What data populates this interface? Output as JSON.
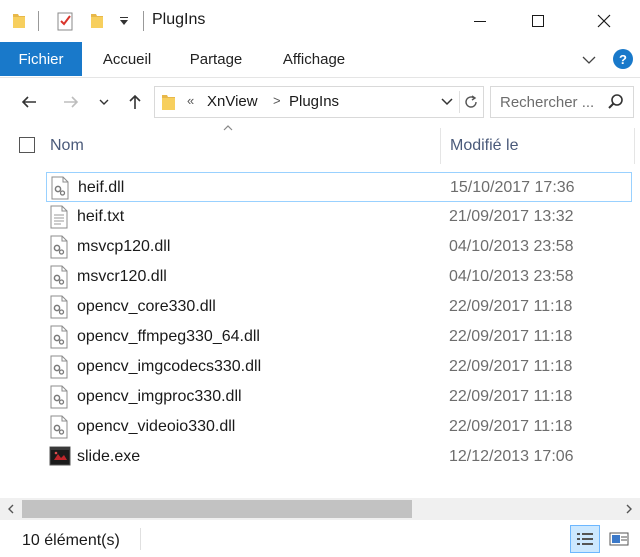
{
  "window": {
    "title": "PlugIns",
    "minimize_icon": "minimize-icon",
    "maximize_icon": "maximize-icon",
    "close_icon": "close-icon"
  },
  "quick_access": {
    "icons": [
      "folder-icon",
      "properties-icon",
      "new-folder-icon",
      "customize-dropdown-icon"
    ]
  },
  "ribbon": {
    "tabs": [
      {
        "label": "Fichier",
        "active": true
      },
      {
        "label": "Accueil"
      },
      {
        "label": "Partage"
      },
      {
        "label": "Affichage"
      }
    ],
    "accent": "#1979ca",
    "help_label": "?"
  },
  "address": {
    "overflow_marker": "«",
    "segments": [
      "XnView",
      "PlugIns"
    ],
    "separator": ">"
  },
  "search": {
    "placeholder": "Rechercher ..."
  },
  "columns": {
    "name": "Nom",
    "modified": "Modifié le"
  },
  "files": [
    {
      "name": "heif.dll",
      "modified": "15/10/2017 17:36",
      "icon": "dll-icon",
      "selected": true
    },
    {
      "name": "heif.txt",
      "modified": "21/09/2017 13:32",
      "icon": "text-file-icon"
    },
    {
      "name": "msvcp120.dll",
      "modified": "04/10/2013 23:58",
      "icon": "dll-icon"
    },
    {
      "name": "msvcr120.dll",
      "modified": "04/10/2013 23:58",
      "icon": "dll-icon"
    },
    {
      "name": "opencv_core330.dll",
      "modified": "22/09/2017 11:18",
      "icon": "dll-icon"
    },
    {
      "name": "opencv_ffmpeg330_64.dll",
      "modified": "22/09/2017 11:18",
      "icon": "dll-icon"
    },
    {
      "name": "opencv_imgcodecs330.dll",
      "modified": "22/09/2017 11:18",
      "icon": "dll-icon"
    },
    {
      "name": "opencv_imgproc330.dll",
      "modified": "22/09/2017 11:18",
      "icon": "dll-icon"
    },
    {
      "name": "opencv_videoio330.dll",
      "modified": "22/09/2017 11:18",
      "icon": "dll-icon"
    },
    {
      "name": "slide.exe",
      "modified": "12/12/2013 17:06",
      "icon": "exe-icon"
    }
  ],
  "status": {
    "count": "10 élément(s)"
  }
}
